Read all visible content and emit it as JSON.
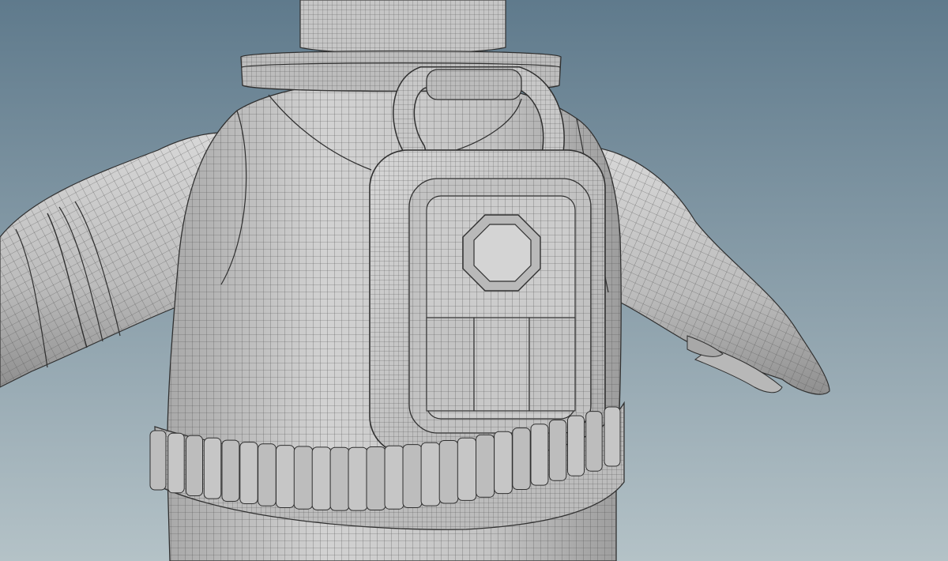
{
  "viewport": {
    "background_top": "#5f7a8c",
    "background_bottom": "#b4c2c7",
    "mesh_fill": "#c9c9c9",
    "mesh_shadow": "#9a9a9a",
    "wire_color": "#4f4f4f",
    "edge_color": "#2f2f2f"
  },
  "belt": {
    "pouch_count": 26
  }
}
